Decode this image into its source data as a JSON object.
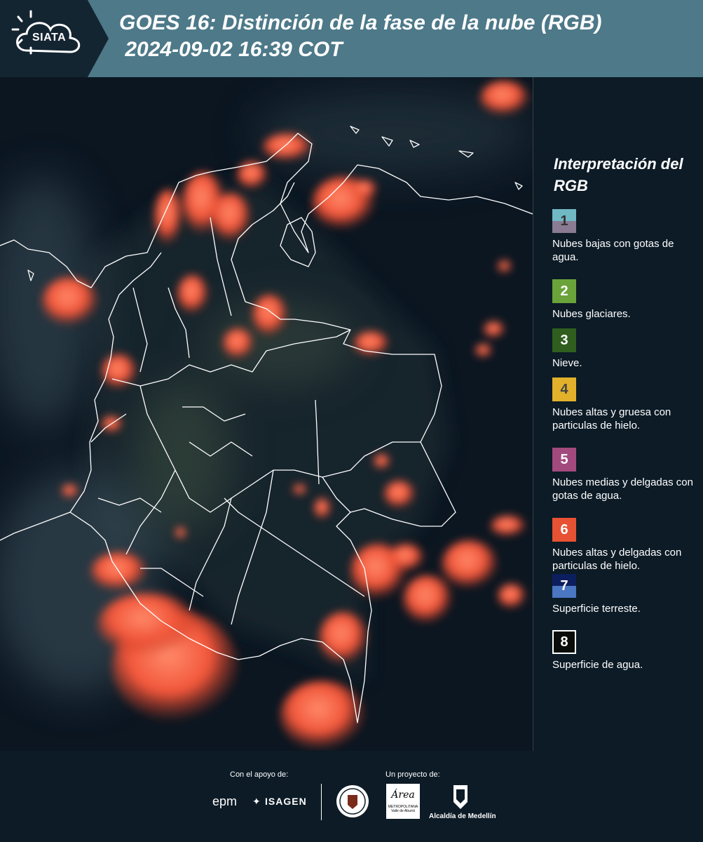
{
  "header": {
    "logo": "SIATA",
    "title": "GOES 16: Distinción de la fase de la nube (RGB)\n 2024-09-02 16:39 COT"
  },
  "legend": {
    "title": "Interpretación del RGB",
    "items": [
      {
        "num": "1",
        "label": "Nubes bajas con gotas de agua.",
        "color_top": "#6fb8c4",
        "color_bottom": "#8a7b93",
        "num_color": "#333333"
      },
      {
        "num": "2",
        "label": "Nubes glaciares.",
        "color_top": "#6aa33a",
        "color_bottom": "#6aa33a",
        "num_color": "#ffffff"
      },
      {
        "num": "3",
        "label": "Nieve.",
        "color_top": "#2f5e1e",
        "color_bottom": "#2f5e1e",
        "num_color": "#ffffff"
      },
      {
        "num": "4",
        "label": "Nubes altas y gruesa con particulas de hielo.",
        "color_top": "#e2b02a",
        "color_bottom": "#e2b02a",
        "num_color": "#444444"
      },
      {
        "num": "5",
        "label": "Nubes medias y delgadas con gotas de agua.",
        "color_top": "#a24a7e",
        "color_bottom": "#a24a7e",
        "num_color": "#ffffff"
      },
      {
        "num": "6",
        "label": "Nubes altas y delgadas con particulas de hielo.",
        "color_top": "#e65233",
        "color_bottom": "#e65233",
        "num_color": "#ffffff"
      },
      {
        "num": "7",
        "label": "Superficie terreste.",
        "color_top": "#0d1e5e",
        "color_bottom": "#4a76c2",
        "num_color": "#ffffff"
      },
      {
        "num": "8",
        "label": "Superficie de agua.",
        "color_top": "#080d0a",
        "color_bottom": "#080d0a",
        "num_color": "#ffffff",
        "border": "#ffffff"
      }
    ]
  },
  "footer": {
    "support_label": "Con el apoyo de:",
    "project_label": "Un proyecto de:",
    "sponsor_epm": "epm",
    "sponsor_isagen": "ISAGEN",
    "partner_area_1": "Área",
    "partner_area_2": "METROPOLITANA",
    "partner_area_3": "Valle de Aburrá",
    "partner_alcaldia": "Alcaldía de Medellín"
  },
  "colors": {
    "header_bg": "#4d7989",
    "page_bg": "#0c1b26",
    "cloud_ice": "#f2563a",
    "boundary": "#ffffff"
  }
}
